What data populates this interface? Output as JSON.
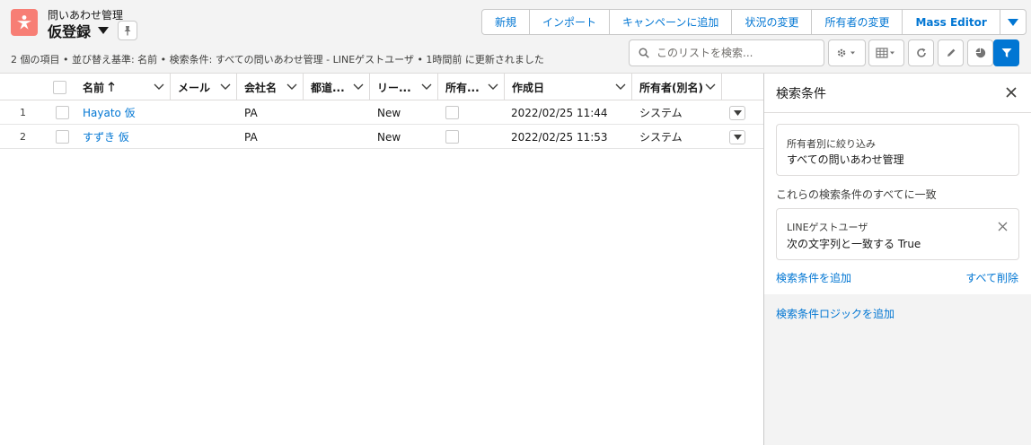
{
  "header": {
    "object_label": "問いあわせ管理",
    "list_title": "仮登録",
    "meta": "2 個の項目 • 並び替え基準: 名前 • 検索条件: すべての問いあわせ管理 - LINEゲストユーザ • 1時間前 に更新されました",
    "buttons": [
      "新規",
      "インポート",
      "キャンペーンに追加",
      "状況の変更",
      "所有者の変更",
      "Mass Editor"
    ],
    "search_placeholder": "このリストを検索..."
  },
  "table": {
    "columns": [
      "名前",
      "メール",
      "会社名",
      "都道...",
      "リー...",
      "所有...",
      "作成日",
      "所有者(別名)"
    ],
    "rows": [
      {
        "num": "1",
        "name": "Hayato 仮",
        "email": "",
        "company": "PA",
        "pref": "",
        "lead": "New",
        "created": "2022/02/25 11:44",
        "owner": "システム"
      },
      {
        "num": "2",
        "name": "すずき 仮",
        "email": "",
        "company": "PA",
        "pref": "",
        "lead": "New",
        "created": "2022/02/25 11:53",
        "owner": "システム"
      }
    ]
  },
  "filter_panel": {
    "title": "検索条件",
    "owner_filter_label": "所有者別に絞り込み",
    "owner_filter_value": "すべての問いあわせ管理",
    "match_text": "これらの検索条件のすべてに一致",
    "condition_field": "LINEゲストユーザ",
    "condition_value": "次の文字列と一致する  True",
    "add_filter": "検索条件を追加",
    "remove_all": "すべて削除",
    "add_logic": "検索条件ロジックを追加"
  },
  "colors": {
    "brand_blue": "#0176d3",
    "object_icon": "#f77e75",
    "header_bg": "#f3f3f3"
  }
}
